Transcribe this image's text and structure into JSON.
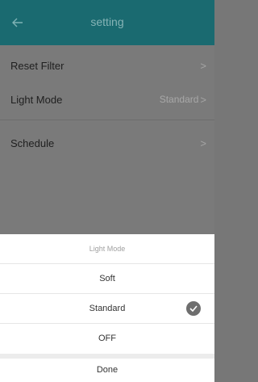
{
  "header": {
    "title": "setting",
    "back_icon": "arrow-left-icon"
  },
  "settings": {
    "reset_filter": {
      "label": "Reset Filter"
    },
    "light_mode": {
      "label": "Light Mode",
      "value": "Standard"
    },
    "schedule": {
      "label": "Schedule"
    }
  },
  "sheet": {
    "title": "Light Mode",
    "options": [
      {
        "label": "Soft",
        "selected": false
      },
      {
        "label": "Standard",
        "selected": true
      },
      {
        "label": "OFF",
        "selected": false
      }
    ],
    "done_label": "Done"
  },
  "colors": {
    "header": "#1a6a70",
    "overlay": "#777777",
    "check": "#6e6e6e"
  }
}
